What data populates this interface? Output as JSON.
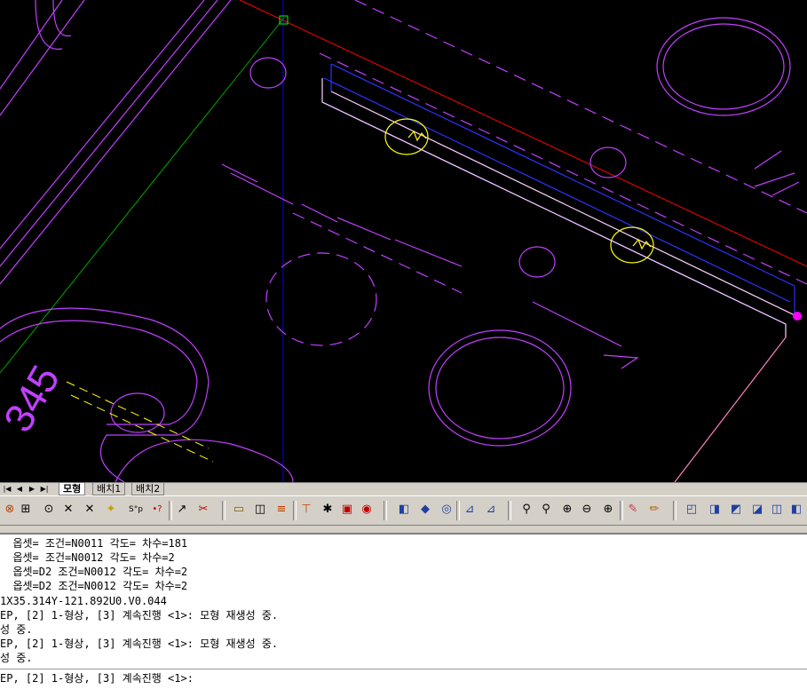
{
  "viewport": {
    "background": "#000000"
  },
  "tabs": {
    "nav": [
      "|◀",
      "◀",
      "▶",
      "▶|"
    ],
    "items": [
      {
        "label": "모형",
        "active": true
      },
      {
        "label": "배치1",
        "active": false
      },
      {
        "label": "배치2",
        "active": false
      }
    ]
  },
  "toolbar_icons": [
    "snap-icon",
    "grid-icon",
    "timer-icon",
    "cross-icon",
    "cross-icon-2",
    "light-icon",
    "sp-icon",
    "help-icon",
    "pick-icon",
    "remove-icon",
    "ruler-icon",
    "zoom-doc-icon",
    "dim-icon",
    "dim-linear-icon",
    "dim-aligned-icon",
    "frame-icon",
    "circle-target-icon",
    "box-3d-icon",
    "cone-3d-icon",
    "torus-icon",
    "ucs-icon",
    "ucs-move-icon",
    "zoom-realtime-icon",
    "zoom-window-icon",
    "zoom-in-icon",
    "zoom-out-icon",
    "zoom-extents-icon",
    "eraser-icon",
    "pencil-icon",
    "named-views-icon",
    "view-top-icon",
    "view-front-icon",
    "view-side-icon",
    "view-iso-icon",
    "view-box-icon"
  ],
  "command_log": [
    "  옵셋= 조건=N0011 각도= 차수=181",
    "  옵셋= 조건=N0012 각도= 차수=2",
    "  옵셋=D2 조건=N0012 각도= 차수=2",
    "  옵셋=D2 조건=N0012 각도= 차수=2",
    "1X35.314Y-121.892U0.V0.044",
    "EP, [2] 1-형상, [3] 계속진행 <1>: 모형 재생성 중.",
    "성 중.",
    "EP, [2] 1-형상, [3] 계속진행 <1>: 모형 재생성 중.",
    "성 중."
  ],
  "prompt_text": "EP, [2] 1-형상, [3] 계속진행 <1>:"
}
